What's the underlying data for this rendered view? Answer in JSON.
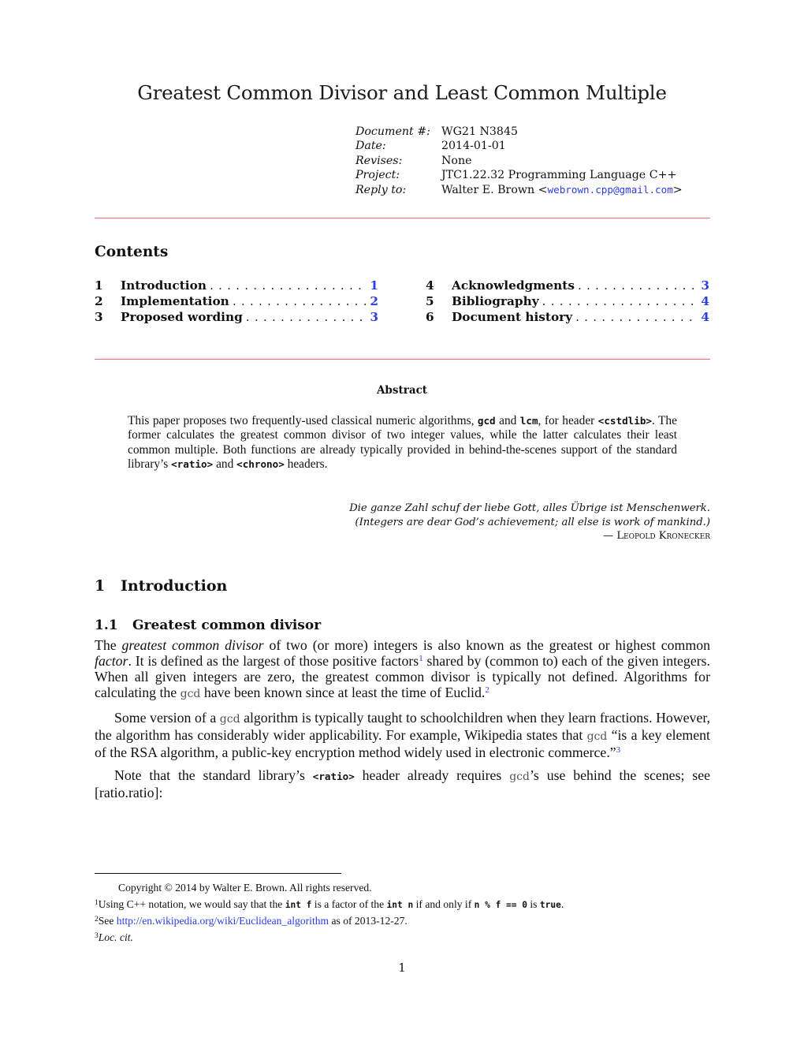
{
  "title": "Greatest Common Divisor and Least Common Multiple",
  "metadata": [
    {
      "key": "Document #:",
      "value": "WG21 N3845"
    },
    {
      "key": "Date:",
      "value": "2014-01-01"
    },
    {
      "key": "Revises:",
      "value": "None"
    },
    {
      "key": "Project:",
      "value": "JTC1.22.32 Programming Language C++"
    },
    {
      "key": "Reply to:",
      "value": "Walter E. Brown <",
      "email": "webrown.cpp@gmail.com",
      "suffix": ">"
    }
  ],
  "contents": {
    "heading": "Contents",
    "left": [
      {
        "num": "1",
        "label": "Introduction",
        "page": "1"
      },
      {
        "num": "2",
        "label": "Implementation",
        "page": "2"
      },
      {
        "num": "3",
        "label": "Proposed wording",
        "page": "3"
      }
    ],
    "right": [
      {
        "num": "4",
        "label": "Acknowledgments",
        "page": "3"
      },
      {
        "num": "5",
        "label": "Bibliography",
        "page": "4"
      },
      {
        "num": "6",
        "label": "Document history",
        "page": "4"
      }
    ]
  },
  "abstract": {
    "heading": "Abstract",
    "t1": "This paper proposes two frequently-used classical numeric algorithms, ",
    "c1": "gcd",
    "t2": " and ",
    "c2": "lcm",
    "t3": ", for header ",
    "c3": "<cstdlib>",
    "t4": ". The former calculates the greatest common divisor of two integer values, while the latter calculates their least common multiple.  Both functions are already typically provided in behind-the-scenes support of the standard library’s ",
    "c4": "<ratio>",
    "t5": " and ",
    "c5": "<chrono>",
    "t6": " headers."
  },
  "epigraph": {
    "line1": "Die ganze Zahl schuf der liebe Gott, alles Übrige ist Menschenwerk.",
    "line2": "(Integers are dear God’s achievement; all else is work of mankind.)",
    "dash": "— ",
    "author": "Leopold Kronecker"
  },
  "section1": {
    "num": "1",
    "title": "Introduction"
  },
  "section1_1": {
    "num": "1.1",
    "title": "Greatest common divisor"
  },
  "para1": {
    "t1": "The ",
    "e1": "greatest common divisor",
    "t2": " of two (or more) integers is also known as the greatest or highest common ",
    "e2": "factor",
    "t3": ". It is defined as the largest of those positive factors",
    "fn1": "1",
    "t4": " shared by (common to) each of the given integers. When all given integers are zero, the greatest common divisor is typically not defined. Algorithms for calculating the ",
    "gcd": "gcd",
    "t5": " have been known since at least the time of Euclid.",
    "fn2": "2"
  },
  "para2": {
    "t1": "Some version of a ",
    "gcd": "gcd",
    "t2": " algorithm is typically taught to schoolchildren when they learn fractions. However, the algorithm has considerably wider applicability.  For example, Wikipedia states that ",
    "gcd2": "gcd",
    "t3": " “is a key element of the RSA algorithm, a public-key encryption method widely used in electronic commerce.”",
    "fn3": "3"
  },
  "para3": {
    "t1": "Note that the standard library’s ",
    "c1": "<ratio>",
    "t2": " header already requires ",
    "gcd": "gcd",
    "t3": "’s use behind the scenes; see [ratio.ratio]:"
  },
  "footnotes": {
    "copyright": "Copyright © 2014 by Walter E. Brown. All rights reserved.",
    "fn1": {
      "mark": "1",
      "t1": "Using C++ notation, we would say that the ",
      "c1": "int f",
      "t2": " is a factor of the ",
      "c2": "int n",
      "t3": " if and only if ",
      "c3": "n % f == 0",
      "t4": " is ",
      "c4": "true",
      "t5": "."
    },
    "fn2": {
      "mark": "2",
      "t1": "See ",
      "link": "http://en.wikipedia.org/wiki/Euclidean_algorithm",
      "t2": " as of 2013-12-27."
    },
    "fn3": {
      "mark": "3",
      "text": "Loc. cit."
    }
  },
  "page_number": "1",
  "colors": {
    "rule": "#f26b6b",
    "link": "#2a3de8"
  }
}
